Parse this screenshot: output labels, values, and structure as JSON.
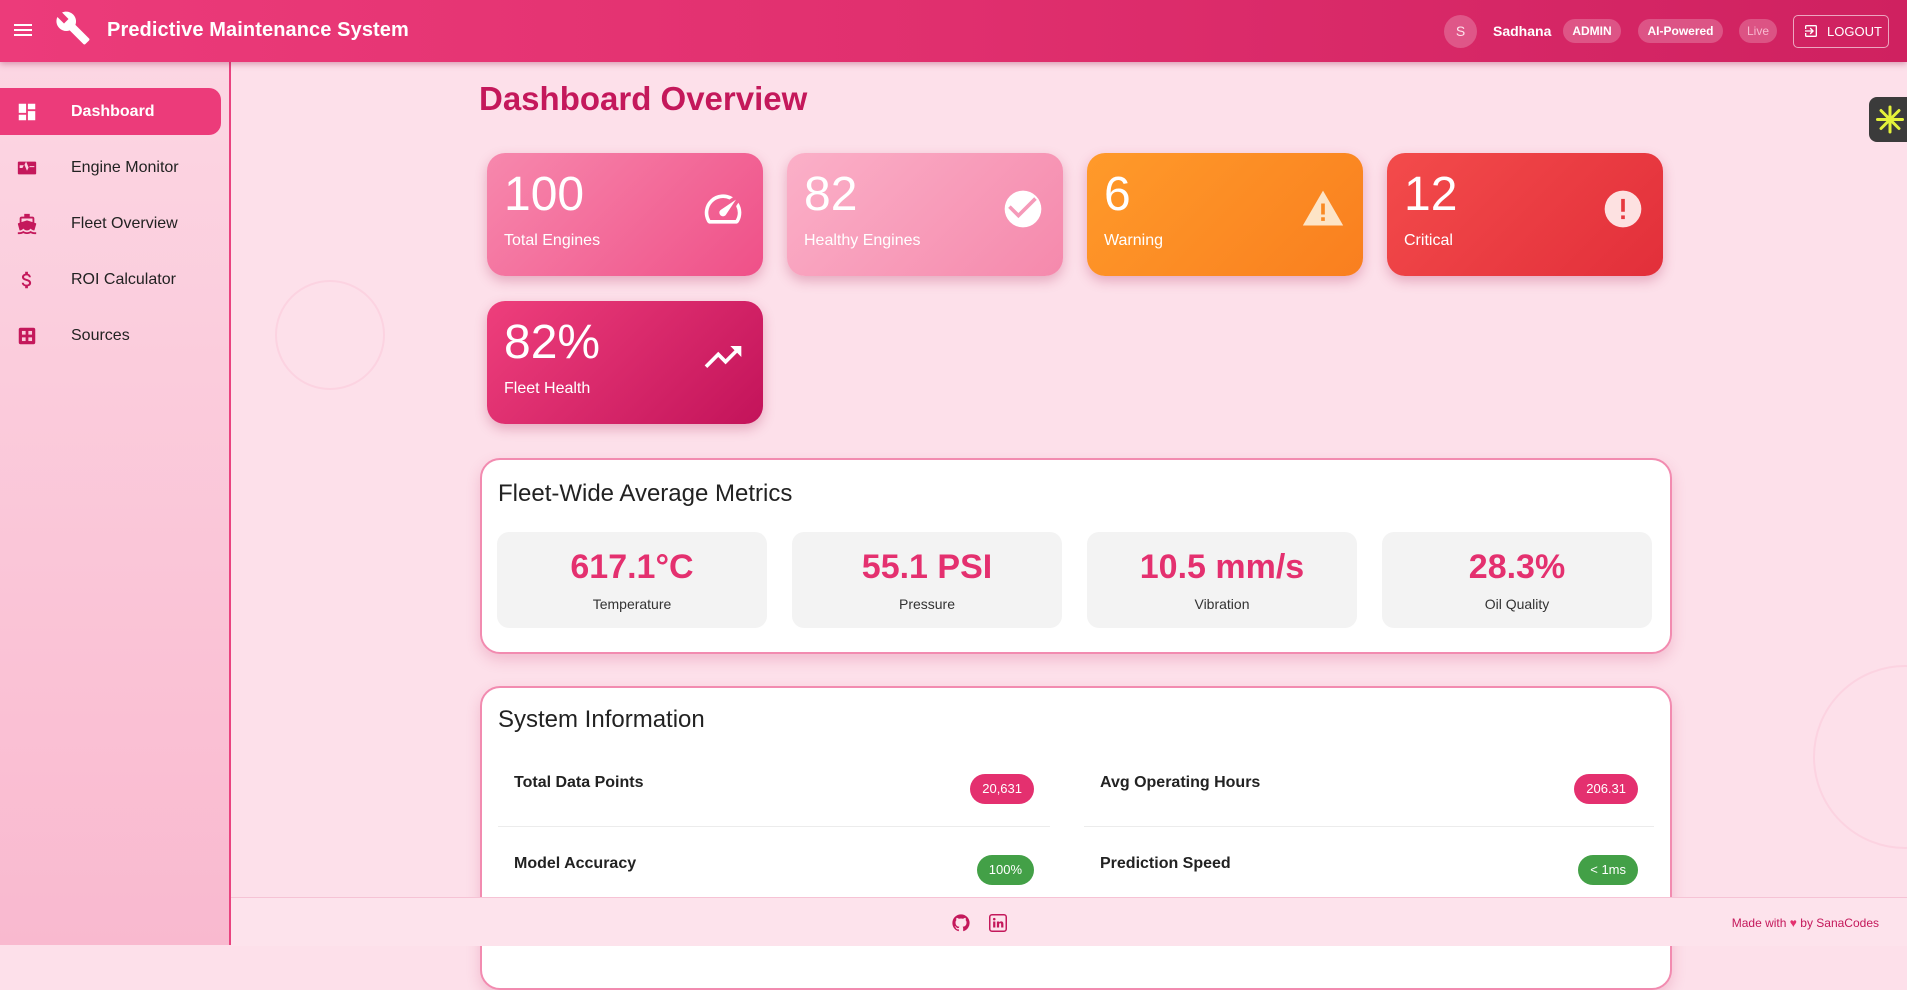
{
  "header": {
    "title": "Predictive Maintenance System",
    "avatar_initial": "S",
    "username": "Sadhana",
    "role_badge": "ADMIN",
    "ai_badge": "AI-Powered",
    "live_badge": "Live",
    "logout_label": "LOGOUT"
  },
  "sidebar": {
    "items": [
      {
        "label": "Dashboard",
        "icon": "dashboard-icon",
        "active": true
      },
      {
        "label": "Engine Monitor",
        "icon": "monitor-heart-icon"
      },
      {
        "label": "Fleet Overview",
        "icon": "ship-icon"
      },
      {
        "label": "ROI Calculator",
        "icon": "dollar-icon"
      },
      {
        "label": "Sources",
        "icon": "apps-icon"
      }
    ]
  },
  "main": {
    "title": "Dashboard Overview",
    "stats": [
      {
        "value": "100",
        "label": "Total Engines",
        "icon": "speedometer-icon"
      },
      {
        "value": "82",
        "label": "Healthy Engines",
        "icon": "check-circle-icon"
      },
      {
        "value": "6",
        "label": "Warning",
        "icon": "warning-icon"
      },
      {
        "value": "12",
        "label": "Critical",
        "icon": "error-icon"
      },
      {
        "value": "82%",
        "label": "Fleet Health",
        "icon": "trending-up-icon"
      }
    ],
    "metrics": {
      "title": "Fleet-Wide Average Metrics",
      "items": [
        {
          "value": "617.1°C",
          "label": "Temperature"
        },
        {
          "value": "55.1 PSI",
          "label": "Pressure"
        },
        {
          "value": "10.5 mm/s",
          "label": "Vibration"
        },
        {
          "value": "28.3%",
          "label": "Oil Quality"
        }
      ]
    },
    "system_info": {
      "title": "System Information",
      "rows": [
        {
          "label": "Total Data Points",
          "value": "20,631"
        },
        {
          "label": "Avg Operating Hours",
          "value": "206.31"
        },
        {
          "label": "Model Accuracy",
          "value": "100%"
        },
        {
          "label": "Prediction Speed",
          "value": "< 1ms"
        }
      ]
    }
  },
  "footer": {
    "made_with": "Made with",
    "by": "by SanaCodes",
    "icons": [
      "github-icon",
      "linkedin-icon"
    ]
  },
  "colors": {
    "brand": "#ec3b7a",
    "dark_brand": "#c4185b",
    "warning": "#f98a23",
    "critical": "#e63a40",
    "success": "#43a047"
  }
}
